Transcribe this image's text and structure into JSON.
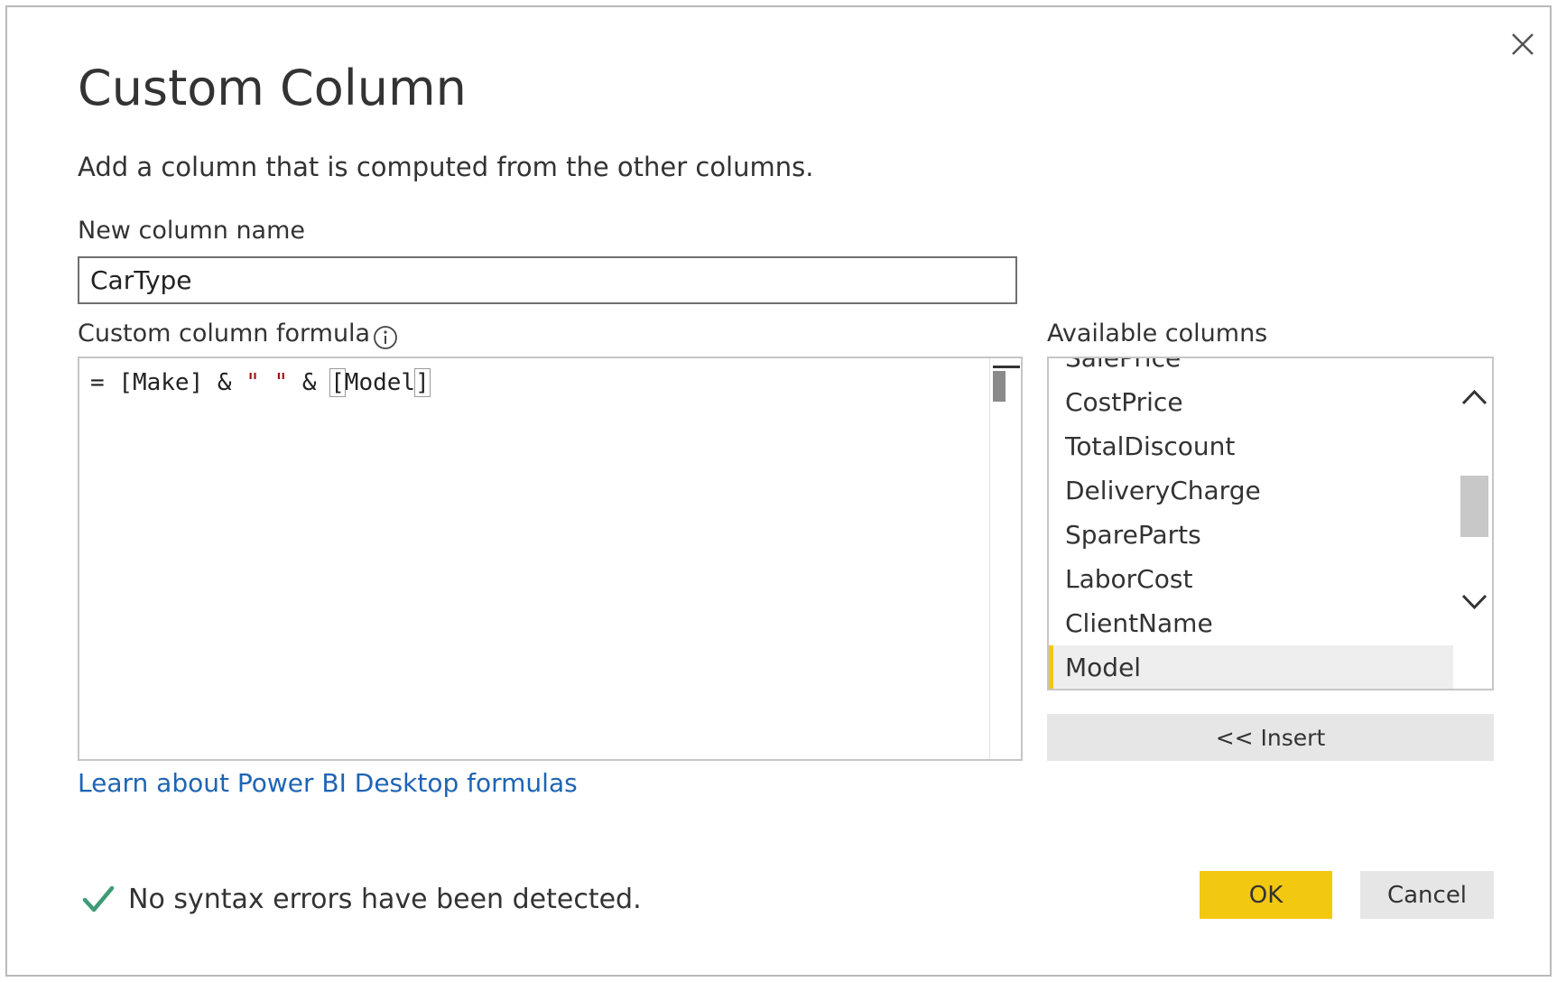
{
  "dialog": {
    "title": "Custom Column",
    "description": "Add a column that is computed from the other columns."
  },
  "new_column": {
    "label": "New column name",
    "value": "CarType"
  },
  "formula": {
    "label": "Custom column formula",
    "tokens": {
      "eq": "= ",
      "make": "[Make]",
      "amp1": " & ",
      "quote": "\" \"",
      "amp2": " & ",
      "open": "[",
      "model": "Model",
      "close": "]"
    }
  },
  "available": {
    "label": "Available columns",
    "items": [
      {
        "label": "SalePrice"
      },
      {
        "label": "CostPrice"
      },
      {
        "label": "TotalDiscount"
      },
      {
        "label": "DeliveryCharge"
      },
      {
        "label": "SpareParts"
      },
      {
        "label": "LaborCost"
      },
      {
        "label": "ClientName"
      },
      {
        "label": "Model",
        "selected": true
      }
    ],
    "insert_label": "<< Insert"
  },
  "link": {
    "label": "Learn about Power BI Desktop formulas"
  },
  "status": {
    "text": "No syntax errors have been detected."
  },
  "buttons": {
    "ok": "OK",
    "cancel": "Cancel"
  },
  "colors": {
    "accent": "#f2c811",
    "link": "#1e64b4",
    "check": "#3f9b76",
    "string_literal": "#a31515"
  },
  "icons": {
    "close": "close-icon",
    "info": "info-icon",
    "scroll_up": "chevron-up-icon",
    "scroll_down": "chevron-down-icon",
    "status": "checkmark-icon"
  }
}
